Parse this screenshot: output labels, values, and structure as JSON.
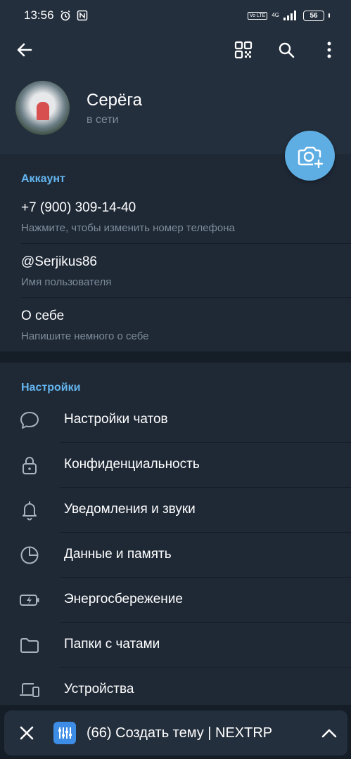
{
  "status_bar": {
    "time": "13:56",
    "volte": "Vo LTE",
    "network": "4G",
    "battery": "56"
  },
  "header": {
    "icons": [
      "back-arrow-icon",
      "qr-code-icon",
      "search-icon",
      "more-vertical-icon"
    ]
  },
  "profile": {
    "name": "Серёга",
    "status": "в сети"
  },
  "account": {
    "title": "Аккаунт",
    "phone": {
      "value": "+7 (900) 309-14-40",
      "hint": "Нажмите, чтобы изменить номер телефона"
    },
    "username": {
      "value": "@Serjikus86",
      "hint": "Имя пользователя"
    },
    "bio": {
      "value": "О себе",
      "hint": "Напишите немного о себе"
    }
  },
  "settings": {
    "title": "Настройки",
    "items": [
      {
        "label": "Настройки чатов",
        "icon": "chat-bubble-icon"
      },
      {
        "label": "Конфиденциальность",
        "icon": "lock-icon"
      },
      {
        "label": "Уведомления и звуки",
        "icon": "bell-icon"
      },
      {
        "label": "Данные и память",
        "icon": "pie-chart-icon"
      },
      {
        "label": "Энергосбережение",
        "icon": "battery-bolt-icon"
      },
      {
        "label": "Папки с чатами",
        "icon": "folder-icon"
      },
      {
        "label": "Устройства",
        "icon": "devices-icon"
      }
    ]
  },
  "bottom_bar": {
    "title": "(66) Создать тему | NEXTRP",
    "app_icon_color": "#3d8de6"
  },
  "colors": {
    "accent": "#64b5ef",
    "fab": "#5eaee4",
    "background": "#151d27",
    "surface": "#1f2936",
    "header": "#242f3d"
  }
}
